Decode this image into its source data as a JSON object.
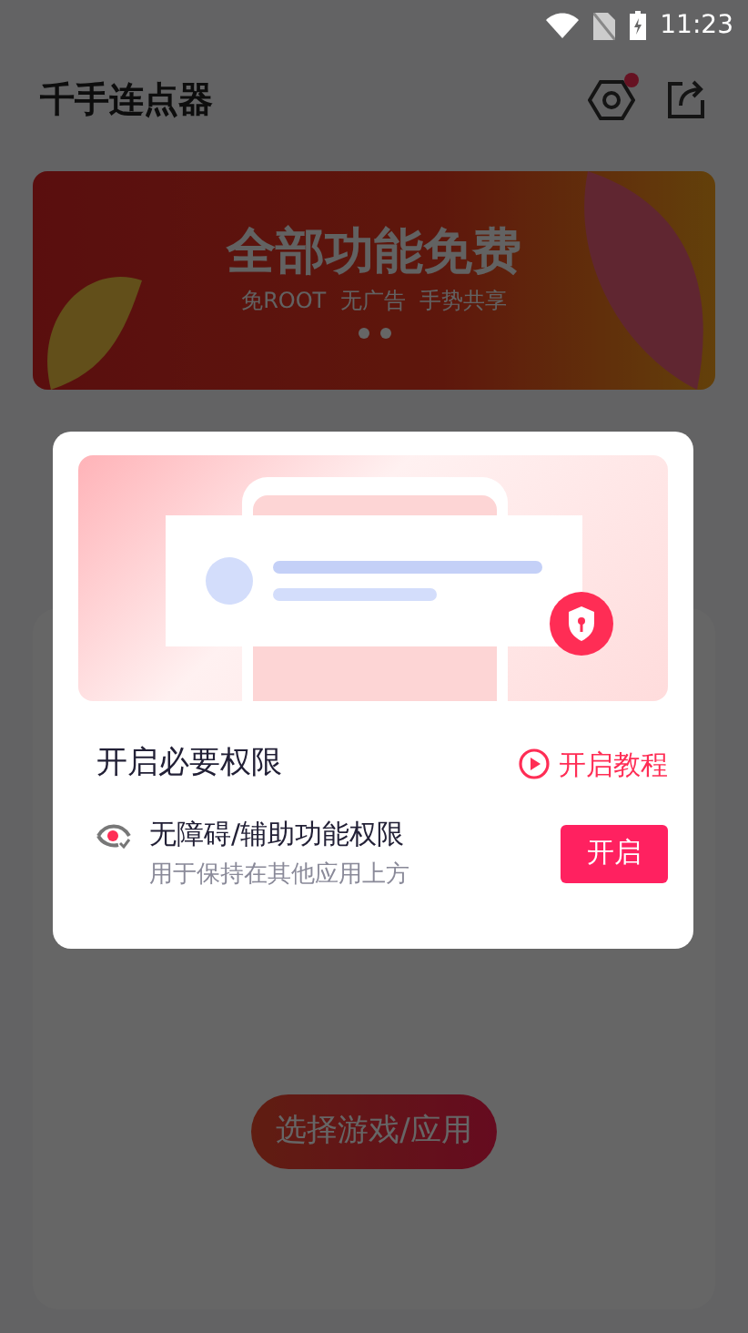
{
  "status_bar": {
    "time": "11:23"
  },
  "header": {
    "title": "千手连点器"
  },
  "banner": {
    "title": "全部功能免费",
    "subtitle": "免ROOT  无广告  手势共享"
  },
  "main_button": {
    "label": "选择游戏/应用"
  },
  "dialog": {
    "title": "开启必要权限",
    "tutorial_link": "开启教程",
    "permissions": [
      {
        "name": "无障碍/辅助功能权限",
        "description": "用于保持在其他应用上方",
        "button": "开启"
      }
    ]
  }
}
